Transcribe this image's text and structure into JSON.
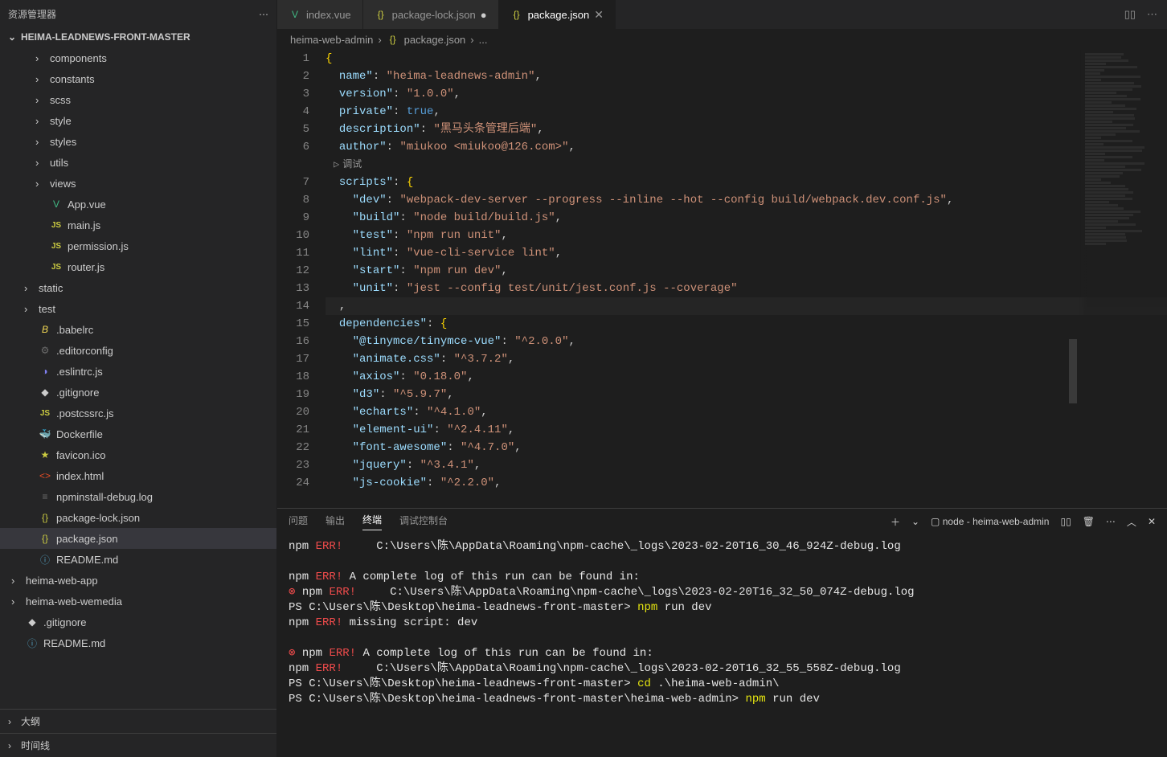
{
  "sidebar": {
    "title": "资源管理器",
    "project": "HEIMA-LEADNEWS-FRONT-MASTER",
    "outline": "大纲",
    "timeline": "时间线"
  },
  "tree": [
    {
      "label": "components",
      "type": "folder",
      "indent": 2
    },
    {
      "label": "constants",
      "type": "folder",
      "indent": 2
    },
    {
      "label": "scss",
      "type": "folder",
      "indent": 2
    },
    {
      "label": "style",
      "type": "folder",
      "indent": 2
    },
    {
      "label": "styles",
      "type": "folder",
      "indent": 2
    },
    {
      "label": "utils",
      "type": "folder",
      "indent": 2
    },
    {
      "label": "views",
      "type": "folder",
      "indent": 2
    },
    {
      "label": "App.vue",
      "type": "vue",
      "indent": 2
    },
    {
      "label": "main.js",
      "type": "js",
      "indent": 2
    },
    {
      "label": "permission.js",
      "type": "js",
      "indent": 2
    },
    {
      "label": "router.js",
      "type": "js",
      "indent": 2
    },
    {
      "label": "static",
      "type": "folder",
      "indent": 1
    },
    {
      "label": "test",
      "type": "folder",
      "indent": 1
    },
    {
      "label": ".babelrc",
      "type": "babel",
      "indent": 1
    },
    {
      "label": ".editorconfig",
      "type": "gear",
      "indent": 1
    },
    {
      "label": ".eslintrc.js",
      "type": "eslint",
      "indent": 1
    },
    {
      "label": ".gitignore",
      "type": "git",
      "indent": 1
    },
    {
      "label": ".postcssrc.js",
      "type": "js",
      "indent": 1
    },
    {
      "label": "Dockerfile",
      "type": "docker",
      "indent": 1
    },
    {
      "label": "favicon.ico",
      "type": "star",
      "indent": 1
    },
    {
      "label": "index.html",
      "type": "html",
      "indent": 1
    },
    {
      "label": "npminstall-debug.log",
      "type": "lines",
      "indent": 1
    },
    {
      "label": "package-lock.json",
      "type": "json",
      "indent": 1
    },
    {
      "label": "package.json",
      "type": "json",
      "indent": 1,
      "selected": true
    },
    {
      "label": "README.md",
      "type": "info",
      "indent": 1
    },
    {
      "label": "heima-web-app",
      "type": "folder",
      "indent": 0
    },
    {
      "label": "heima-web-wemedia",
      "type": "folder",
      "indent": 0
    },
    {
      "label": ".gitignore",
      "type": "git",
      "indent": 0
    },
    {
      "label": "README.md",
      "type": "info",
      "indent": 0
    }
  ],
  "tabs": {
    "items": [
      {
        "label": "index.vue",
        "icon": "vue",
        "state": ""
      },
      {
        "label": "package-lock.json",
        "icon": "json",
        "state": "dirty"
      },
      {
        "label": "package.json",
        "icon": "json",
        "state": "active"
      }
    ]
  },
  "breadcrumb": {
    "seg0": "heima-web-admin",
    "seg1": "package.json",
    "seg2": "..."
  },
  "code": {
    "debugLens": "调试",
    "lines": [
      {
        "n": 1,
        "html": "<span class='tk-brace'>{</span>"
      },
      {
        "n": 2,
        "html": "  <span class='tk-key'>name\"</span><span class='tk-punc'>:</span> <span class='tk-str'>\"heima-leadnews-admin\"</span><span class='tk-punc'>,</span>"
      },
      {
        "n": 3,
        "html": "  <span class='tk-key'>version\"</span><span class='tk-punc'>:</span> <span class='tk-str'>\"1.0.0\"</span><span class='tk-punc'>,</span>"
      },
      {
        "n": 4,
        "html": "  <span class='tk-key'>private\"</span><span class='tk-punc'>:</span> <span class='tk-bool'>true</span><span class='tk-punc'>,</span>"
      },
      {
        "n": 5,
        "html": "  <span class='tk-key'>description\"</span><span class='tk-punc'>:</span> <span class='tk-str'>\"黑马头条管理后端\"</span><span class='tk-punc'>,</span>"
      },
      {
        "n": 6,
        "html": "  <span class='tk-key'>author\"</span><span class='tk-punc'>:</span> <span class='tk-str'>\"miukoo &lt;miukoo@126.com&gt;\"</span><span class='tk-punc'>,</span>",
        "lens": true
      },
      {
        "n": 7,
        "html": "  <span class='tk-key'>scripts\"</span><span class='tk-punc'>:</span> <span class='tk-brace'>{</span>"
      },
      {
        "n": 8,
        "html": "    <span class='tk-key'>\"dev\"</span><span class='tk-punc'>:</span> <span class='tk-str'>\"webpack-dev-server --progress --inline --hot --config build/webpack.dev.conf.js\"</span><span class='tk-punc'>,</span>"
      },
      {
        "n": 9,
        "html": "    <span class='tk-key'>\"build\"</span><span class='tk-punc'>:</span> <span class='tk-str'>\"node build/build.js\"</span><span class='tk-punc'>,</span>"
      },
      {
        "n": 10,
        "html": "    <span class='tk-key'>\"test\"</span><span class='tk-punc'>:</span> <span class='tk-str'>\"npm run unit\"</span><span class='tk-punc'>,</span>"
      },
      {
        "n": 11,
        "html": "    <span class='tk-key'>\"lint\"</span><span class='tk-punc'>:</span> <span class='tk-str'>\"vue-cli-service lint\"</span><span class='tk-punc'>,</span>"
      },
      {
        "n": 12,
        "html": "    <span class='tk-key'>\"start\"</span><span class='tk-punc'>:</span> <span class='tk-str'>\"npm run dev\"</span><span class='tk-punc'>,</span>"
      },
      {
        "n": 13,
        "html": "    <span class='tk-key'>\"unit\"</span><span class='tk-punc'>:</span> <span class='tk-str'>\"jest --config test/unit/jest.conf.js --coverage\"</span>"
      },
      {
        "n": 14,
        "html": "  <span class='tk-punc'>,</span>",
        "hl": true
      },
      {
        "n": 15,
        "html": "  <span class='tk-key'>dependencies\"</span><span class='tk-punc'>:</span> <span class='tk-brace'>{</span>"
      },
      {
        "n": 16,
        "html": "    <span class='tk-key'>\"@tinymce/tinymce-vue\"</span><span class='tk-punc'>:</span> <span class='tk-str'>\"^2.0.0\"</span><span class='tk-punc'>,</span>"
      },
      {
        "n": 17,
        "html": "    <span class='tk-key'>\"animate.css\"</span><span class='tk-punc'>:</span> <span class='tk-str'>\"^3.7.2\"</span><span class='tk-punc'>,</span>"
      },
      {
        "n": 18,
        "html": "    <span class='tk-key'>\"axios\"</span><span class='tk-punc'>:</span> <span class='tk-str'>\"0.18.0\"</span><span class='tk-punc'>,</span>"
      },
      {
        "n": 19,
        "html": "    <span class='tk-key'>\"d3\"</span><span class='tk-punc'>:</span> <span class='tk-str'>\"^5.9.7\"</span><span class='tk-punc'>,</span>"
      },
      {
        "n": 20,
        "html": "    <span class='tk-key'>\"echarts\"</span><span class='tk-punc'>:</span> <span class='tk-str'>\"^4.1.0\"</span><span class='tk-punc'>,</span>"
      },
      {
        "n": 21,
        "html": "    <span class='tk-key'>\"element-ui\"</span><span class='tk-punc'>:</span> <span class='tk-str'>\"^2.4.11\"</span><span class='tk-punc'>,</span>"
      },
      {
        "n": 22,
        "html": "    <span class='tk-key'>\"font-awesome\"</span><span class='tk-punc'>:</span> <span class='tk-str'>\"^4.7.0\"</span><span class='tk-punc'>,</span>"
      },
      {
        "n": 23,
        "html": "    <span class='tk-key'>\"jquery\"</span><span class='tk-punc'>:</span> <span class='tk-str'>\"^3.4.1\"</span><span class='tk-punc'>,</span>"
      },
      {
        "n": 24,
        "html": "    <span class='tk-key'>\"js-cookie\"</span><span class='tk-punc'>:</span> <span class='tk-str'>\"^2.2.0\"</span><span class='tk-punc'>,</span>"
      }
    ]
  },
  "panel": {
    "tabs": {
      "problems": "问题",
      "output": "输出",
      "terminal": "终端",
      "debug": "调试控制台"
    },
    "shell": "node - heima-web-admin"
  },
  "terminal": [
    {
      "cls": "",
      "parts": [
        {
          "c": "t-white",
          "t": "npm "
        },
        {
          "c": "t-red",
          "t": "ERR!"
        },
        {
          "c": "t-white",
          "t": "     C:\\Users\\陈\\AppData\\Roaming\\npm-cache\\_logs\\2023-02-20T16_30_46_924Z-debug.log"
        }
      ]
    },
    {
      "cls": "",
      "parts": [
        {
          "c": "t-white",
          "t": " "
        }
      ]
    },
    {
      "cls": "",
      "parts": [
        {
          "c": "t-white",
          "t": "npm "
        },
        {
          "c": "t-red",
          "t": "ERR!"
        },
        {
          "c": "t-white",
          "t": " A complete log of this run can be found in:"
        }
      ]
    },
    {
      "cls": "",
      "parts": [
        {
          "c": "t-err-dot",
          "t": "⊗ "
        },
        {
          "c": "t-white",
          "t": "npm "
        },
        {
          "c": "t-red",
          "t": "ERR!"
        },
        {
          "c": "t-white",
          "t": "     C:\\Users\\陈\\AppData\\Roaming\\npm-cache\\_logs\\2023-02-20T16_32_50_074Z-debug.log"
        }
      ]
    },
    {
      "cls": "",
      "parts": [
        {
          "c": "t-white",
          "t": "PS C:\\Users\\陈\\Desktop\\heima-leadnews-front-master> "
        },
        {
          "c": "t-yellow",
          "t": "npm "
        },
        {
          "c": "t-white",
          "t": "run dev"
        }
      ]
    },
    {
      "cls": "",
      "parts": [
        {
          "c": "t-white",
          "t": "npm "
        },
        {
          "c": "t-red",
          "t": "ERR!"
        },
        {
          "c": "t-white",
          "t": " missing script: dev"
        }
      ]
    },
    {
      "cls": "",
      "parts": [
        {
          "c": "t-white",
          "t": " "
        }
      ]
    },
    {
      "cls": "",
      "parts": [
        {
          "c": "t-err-dot",
          "t": "⊗ "
        },
        {
          "c": "t-white",
          "t": "npm "
        },
        {
          "c": "t-red",
          "t": "ERR!"
        },
        {
          "c": "t-white",
          "t": " A complete log of this run can be found in:"
        }
      ]
    },
    {
      "cls": "",
      "parts": [
        {
          "c": "t-white",
          "t": "npm "
        },
        {
          "c": "t-red",
          "t": "ERR!"
        },
        {
          "c": "t-white",
          "t": "     C:\\Users\\陈\\AppData\\Roaming\\npm-cache\\_logs\\2023-02-20T16_32_55_558Z-debug.log"
        }
      ]
    },
    {
      "cls": "",
      "parts": [
        {
          "c": "t-white",
          "t": "PS C:\\Users\\陈\\Desktop\\heima-leadnews-front-master> "
        },
        {
          "c": "t-yellow",
          "t": "cd "
        },
        {
          "c": "t-white",
          "t": ".\\heima-web-admin\\"
        }
      ]
    },
    {
      "cls": "",
      "parts": [
        {
          "c": "t-white",
          "t": "PS C:\\Users\\陈\\Desktop\\heima-leadnews-front-master\\heima-web-admin> "
        },
        {
          "c": "t-yellow",
          "t": "npm "
        },
        {
          "c": "t-white",
          "t": "run dev"
        }
      ]
    }
  ]
}
